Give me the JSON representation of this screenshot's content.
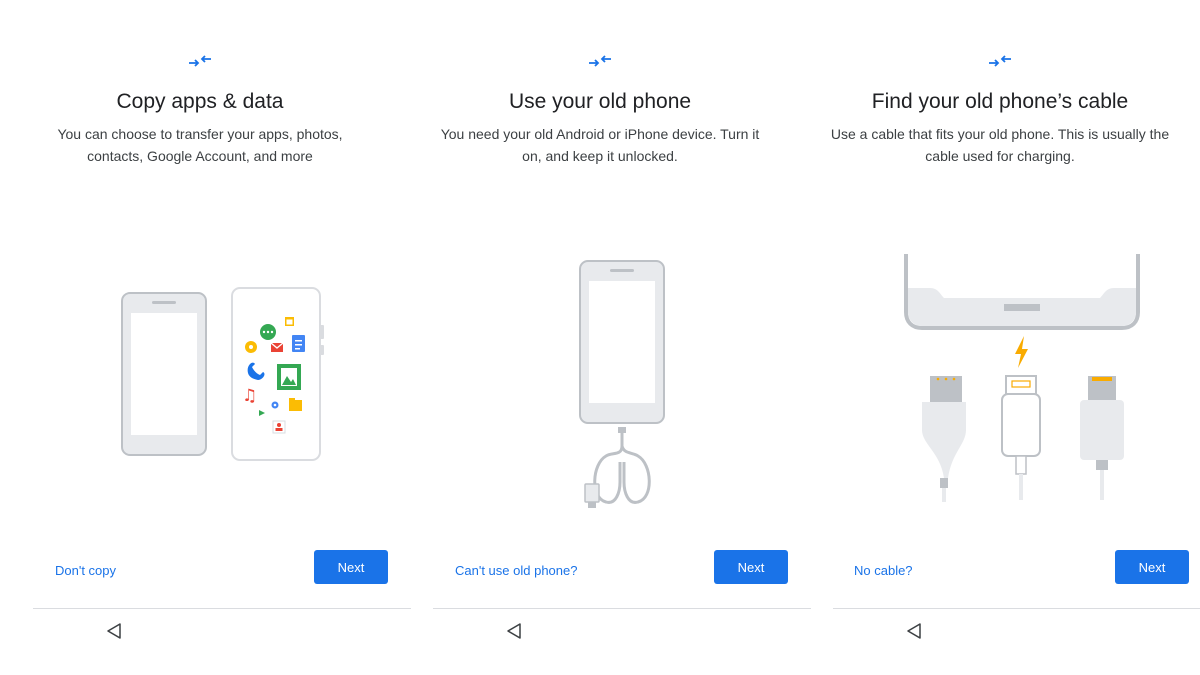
{
  "screens": [
    {
      "title": "Copy apps & data",
      "subtitle": "You can choose to transfer your apps, photos, contacts, Google Account, and more",
      "secondary_label": "Don't copy",
      "next_label": "Next"
    },
    {
      "title": "Use your old phone",
      "subtitle": "You need your old Android or iPhone device. Turn it on, and keep it unlocked.",
      "secondary_label": "Can't use old phone?",
      "next_label": "Next"
    },
    {
      "title": "Find your old phone’s cable",
      "subtitle": "Use a cable that fits your old phone. This is usually the cable used for charging.",
      "secondary_label": "No cable?",
      "next_label": "Next"
    }
  ],
  "icons": {
    "header": "transfer-arrows-icon",
    "nav_back": "back-triangle-icon"
  },
  "colors": {
    "accent": "#1a73e8",
    "phone_frame": "#dadce0",
    "bolt": "#f9ab00"
  }
}
